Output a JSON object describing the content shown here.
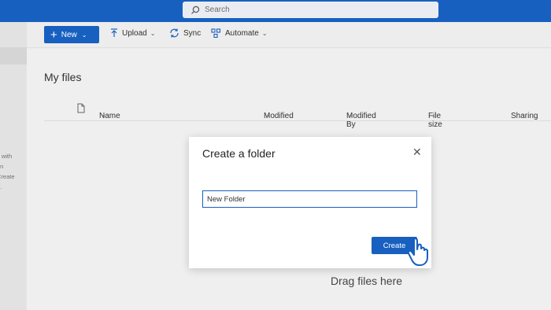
{
  "search": {
    "placeholder": "Search"
  },
  "toolbar": {
    "new_label": "New",
    "upload_label": "Upload",
    "sync_label": "Sync",
    "automate_label": "Automate"
  },
  "left_pane": {
    "hint_text": "s with\non\nCreate\ne."
  },
  "main": {
    "title": "My files",
    "columns": [
      "Name",
      "Modified",
      "Modified By",
      "File size",
      "Sharing"
    ],
    "drag_text": "Drag files here"
  },
  "dialog": {
    "title": "Create a folder",
    "folder_name_value": "New Folder",
    "create_label": "Create"
  },
  "colors": {
    "accent": "#1760c0"
  }
}
